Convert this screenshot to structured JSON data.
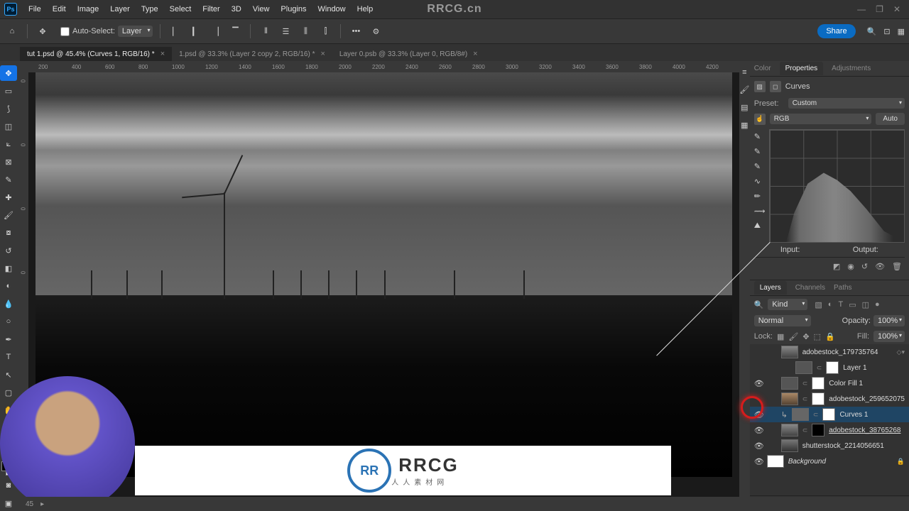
{
  "brand": "RRCG.cn",
  "menu": [
    "File",
    "Edit",
    "Image",
    "Layer",
    "Type",
    "Select",
    "Filter",
    "3D",
    "View",
    "Plugins",
    "Window",
    "Help"
  ],
  "options": {
    "auto_select_label": "Auto-Select:",
    "target": "Layer",
    "share": "Share"
  },
  "tabs": [
    {
      "label": "tut 1.psd @ 45.4% (Curves 1, RGB/16) *",
      "active": true
    },
    {
      "label": "1.psd @ 33.3% (Layer 2 copy 2, RGB/16) *",
      "active": false
    },
    {
      "label": "Layer 0.psb @ 33.3% (Layer 0, RGB/8#)",
      "active": false
    }
  ],
  "ruler_h": [
    "200",
    "400",
    "600",
    "800",
    "1000",
    "1200",
    "1400",
    "1600",
    "1800",
    "2000",
    "2200",
    "2400",
    "2600",
    "2800",
    "3000",
    "3200",
    "3400",
    "3600",
    "3800",
    "4000",
    "4200"
  ],
  "ruler_v": [
    "0",
    "0",
    "0",
    "0"
  ],
  "panels_top": {
    "tabs": [
      "Color",
      "Properties",
      "Adjustments"
    ],
    "active": 1
  },
  "properties": {
    "title": "Curves",
    "preset_label": "Preset:",
    "preset_value": "Custom",
    "channel_value": "RGB",
    "auto": "Auto",
    "input": "Input:",
    "output": "Output:"
  },
  "panels_bottom": {
    "tabs": [
      "Layers",
      "Channels",
      "Paths"
    ],
    "active": 0
  },
  "layers_panel": {
    "kind": "Kind",
    "blend": "Normal",
    "opacity_label": "Opacity:",
    "opacity_value": "100%",
    "lock_label": "Lock:",
    "fill_label": "Fill:",
    "fill_value": "100%"
  },
  "layers": [
    {
      "eye": false,
      "indent": 1,
      "thumb": "img",
      "mask": "none",
      "name": "adobestock_179735764",
      "smart": true
    },
    {
      "eye": false,
      "indent": 2,
      "thumb": "img",
      "mask": "white",
      "name": "Layer 1"
    },
    {
      "eye": true,
      "indent": 1,
      "thumb": "solid",
      "mask": "white",
      "name": "Color Fill 1"
    },
    {
      "eye": false,
      "indent": 1,
      "thumb": "img",
      "mask": "white",
      "name": "adobestock_259652075"
    },
    {
      "eye": true,
      "indent": 1,
      "thumb": "adj",
      "mask": "white",
      "name": "Curves 1",
      "selected": true
    },
    {
      "eye": true,
      "indent": 1,
      "thumb": "img",
      "mask": "black",
      "name": "adobestock_38765268",
      "linked": true
    },
    {
      "eye": true,
      "indent": 1,
      "thumb": "img",
      "mask": "none",
      "name": "shutterstock_2214056651"
    },
    {
      "eye": true,
      "indent": 0,
      "thumb": "img",
      "mask": "none",
      "name": "Background",
      "italic": true,
      "locked": true
    }
  ],
  "logo": {
    "big": "RRCG",
    "sub": "人人素材网"
  },
  "zoom": "45"
}
